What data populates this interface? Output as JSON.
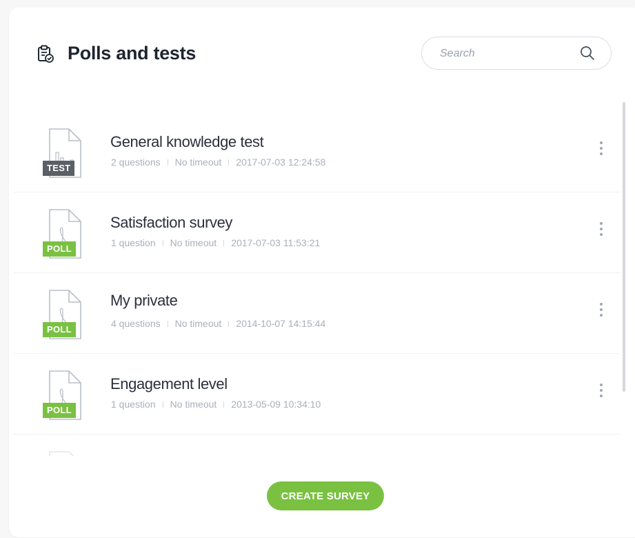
{
  "header": {
    "title": "Polls and tests",
    "icon": "clipboard-check-icon"
  },
  "search": {
    "placeholder": "Search",
    "value": ""
  },
  "items": [
    {
      "title": "General knowledge test",
      "type": "TEST",
      "type_color": "#5b5f66",
      "doc_icon": "chart-document-icon",
      "questions": "2 questions",
      "timeout": "No timeout",
      "date": "2017-07-03 12:24:58"
    },
    {
      "title": "Satisfaction survey",
      "type": "POLL",
      "type_color": "#7ac142",
      "doc_icon": "pdf-document-icon",
      "questions": "1 question",
      "timeout": "No timeout",
      "date": "2017-07-03 11:53:21"
    },
    {
      "title": "My private",
      "type": "POLL",
      "type_color": "#7ac142",
      "doc_icon": "pdf-document-icon",
      "questions": "4 questions",
      "timeout": "No timeout",
      "date": "2014-10-07 14:15:44"
    },
    {
      "title": "Engagement level",
      "type": "POLL",
      "type_color": "#7ac142",
      "doc_icon": "pdf-document-icon",
      "questions": "1 question",
      "timeout": "No timeout",
      "date": "2013-05-09 10:34:10"
    }
  ],
  "actions": {
    "create_label": "CREATE SURVEY"
  },
  "colors": {
    "accent": "#7ac142",
    "test_badge": "#5b5f66",
    "title_text": "#1f2430",
    "meta_text": "#a8b0bb"
  }
}
